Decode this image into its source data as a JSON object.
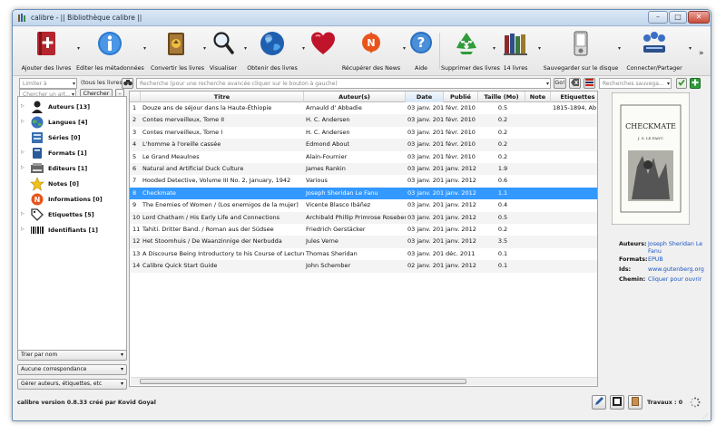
{
  "window": {
    "title": "calibre - || Bibliothèque calibre ||",
    "minimize": "–",
    "maximize": "□",
    "close": "✕"
  },
  "toolbar": [
    {
      "id": "add",
      "label": "Ajouter des livres",
      "icon": "add-book-icon"
    },
    {
      "id": "edit",
      "label": "Editer les métadonnées",
      "icon": "info-icon"
    },
    {
      "id": "convert",
      "label": "Convertir les livres",
      "icon": "convert-book-icon"
    },
    {
      "id": "view",
      "label": "Visualiser",
      "icon": "magnifier-icon"
    },
    {
      "id": "news",
      "label": "Obtenir des livres",
      "icon": "globe-icon"
    },
    {
      "id": "heart",
      "label": "",
      "icon": "heart-icon"
    },
    {
      "id": "fetch",
      "label": "Récupérer des News",
      "icon": "news-icon"
    },
    {
      "id": "help",
      "label": "Aide",
      "icon": "help-icon"
    },
    {
      "id": "delete",
      "label": "Supprimer des livres",
      "icon": "recycle-icon"
    },
    {
      "id": "library",
      "label": "14 livres",
      "icon": "library-icon"
    },
    {
      "id": "device",
      "label": "Sauvegarder sur le disque",
      "icon": "save-disk-icon"
    },
    {
      "id": "connect",
      "label": "Connecter/Partager",
      "icon": "connect-share-icon"
    }
  ],
  "toolbar_more": "»",
  "search": {
    "limit_placeholder": "Limiter à",
    "all_books_label": "(tous les livres)",
    "placeholder": "Recherche (pour une recherche avancée cliquer sur le bouton à gauche)",
    "go_label": "Go!",
    "saved_placeholder": "Recherches sauvega..."
  },
  "tag_browser": {
    "find_placeholder": "Chercher un art...",
    "find_button": "Chercher",
    "collapse_button": "-",
    "items": [
      {
        "label": "Auteurs [13]",
        "icon": "user-icon"
      },
      {
        "label": "Langues [4]",
        "icon": "languages-icon"
      },
      {
        "label": "Séries [0]",
        "icon": "series-icon"
      },
      {
        "label": "Formats [1]",
        "icon": "book-icon"
      },
      {
        "label": "Editeurs [1]",
        "icon": "publisher-icon"
      },
      {
        "label": "Notes [0]",
        "icon": "star-icon"
      },
      {
        "label": "Informations [0]",
        "icon": "news-icon"
      },
      {
        "label": "Etiquettes [5]",
        "icon": "tag-icon"
      },
      {
        "label": "Identifiants [1]",
        "icon": "barcode-icon"
      }
    ],
    "sort_by": "Trier par nom",
    "match": "Aucune correspondance",
    "manage": "Gérer auteurs, étiquettes, etc"
  },
  "table": {
    "columns": [
      "Titre",
      "Auteur(s)",
      "Date",
      "Publié",
      "Taille (Mo)",
      "Note",
      "Etiquettes"
    ],
    "selected_index": 7,
    "rows": [
      {
        "n": "1",
        "title": "Douze ans de séjour dans la Haute-Éthiopie",
        "author": "Arnauld d' Abbadie",
        "date": "03 janv. 2012",
        "pub": "févr. 2010",
        "size": "0.5",
        "rating": "",
        "tags": "1815-1894, Ab"
      },
      {
        "n": "2",
        "title": "Contes merveilleux, Tome II",
        "author": "H. C. Andersen",
        "date": "03 janv. 2012",
        "pub": "févr. 2010",
        "size": "0.2",
        "rating": "",
        "tags": ""
      },
      {
        "n": "3",
        "title": "Contes merveilleux, Tome I",
        "author": "H. C. Andersen",
        "date": "03 janv. 2012",
        "pub": "févr. 2010",
        "size": "0.2",
        "rating": "",
        "tags": ""
      },
      {
        "n": "4",
        "title": "L'homme à l'oreille cassée",
        "author": "Edmond About",
        "date": "03 janv. 2012",
        "pub": "févr. 2010",
        "size": "0.2",
        "rating": "",
        "tags": ""
      },
      {
        "n": "5",
        "title": "Le Grand Meaulnes",
        "author": "Alain-Fournier",
        "date": "03 janv. 2012",
        "pub": "févr. 2010",
        "size": "0.2",
        "rating": "",
        "tags": ""
      },
      {
        "n": "6",
        "title": "Natural and Artificial Duck Culture",
        "author": "James Rankin",
        "date": "03 janv. 2012",
        "pub": "janv. 2012",
        "size": "1.9",
        "rating": "",
        "tags": ""
      },
      {
        "n": "7",
        "title": "Hooded Detective, Volume III No. 2, January, 1942",
        "author": "Various",
        "date": "03 janv. 2012",
        "pub": "janv. 2012",
        "size": "0.6",
        "rating": "",
        "tags": ""
      },
      {
        "n": "8",
        "title": "Checkmate",
        "author": "Joseph Sheridan Le Fanu",
        "date": "03 janv. 2012",
        "pub": "janv. 2012",
        "size": "1.1",
        "rating": "",
        "tags": ""
      },
      {
        "n": "9",
        "title": "The Enemies of Women / (Los enemigos de la mujer)",
        "author": "Vicente Blasco Ibáñez",
        "date": "03 janv. 2012",
        "pub": "janv. 2012",
        "size": "0.4",
        "rating": "",
        "tags": ""
      },
      {
        "n": "10",
        "title": "Lord Chatham / His Early Life and Connections",
        "author": "Archibald Phillip Primrose Rosebery",
        "date": "03 janv. 2012",
        "pub": "janv. 2012",
        "size": "0.5",
        "rating": "",
        "tags": ""
      },
      {
        "n": "11",
        "title": "Tahiti. Dritter Band. / Roman aus der Südsee",
        "author": "Friedrich Gerstäcker",
        "date": "03 janv. 2012",
        "pub": "janv. 2012",
        "size": "0.2",
        "rating": "",
        "tags": ""
      },
      {
        "n": "12",
        "title": "Het Stoomhuis / De Waanzinnige der Nerbudda",
        "author": "Jules Verne",
        "date": "03 janv. 2012",
        "pub": "janv. 2012",
        "size": "3.5",
        "rating": "",
        "tags": ""
      },
      {
        "n": "13",
        "title": "A Discourse Being Introductory to his Course of Lectures...",
        "author": "Thomas Sheridan",
        "date": "03 janv. 2012",
        "pub": "déc. 2011",
        "size": "0.1",
        "rating": "",
        "tags": ""
      },
      {
        "n": "14",
        "title": "Calibre Quick Start Guide",
        "author": "John Schember",
        "date": "02 janv. 2012",
        "pub": "janv. 2012",
        "size": "0.1",
        "rating": "",
        "tags": ""
      }
    ]
  },
  "details": {
    "cover_title": "CHECKMATE",
    "cover_author": "J. S. LE FANU",
    "authors_label": "Auteurs:",
    "authors_value_1": "Joseph Sheridan Le",
    "authors_value_2": "Fanu",
    "formats_label": "Formats:",
    "formats_value": "EPUB",
    "ids_label": "Ids:",
    "ids_value": "www.gutenberg.org",
    "path_label": "Chemin:",
    "path_value": "Cliquer pour ouvrir"
  },
  "status": {
    "version": "calibre version 0.8.33 créé par Kovid Goyal",
    "jobs": "Travaux : 0"
  },
  "colors": {
    "selection": "#3399ff",
    "link": "#1a55c2",
    "sorted_header": "#d6e6f5"
  }
}
